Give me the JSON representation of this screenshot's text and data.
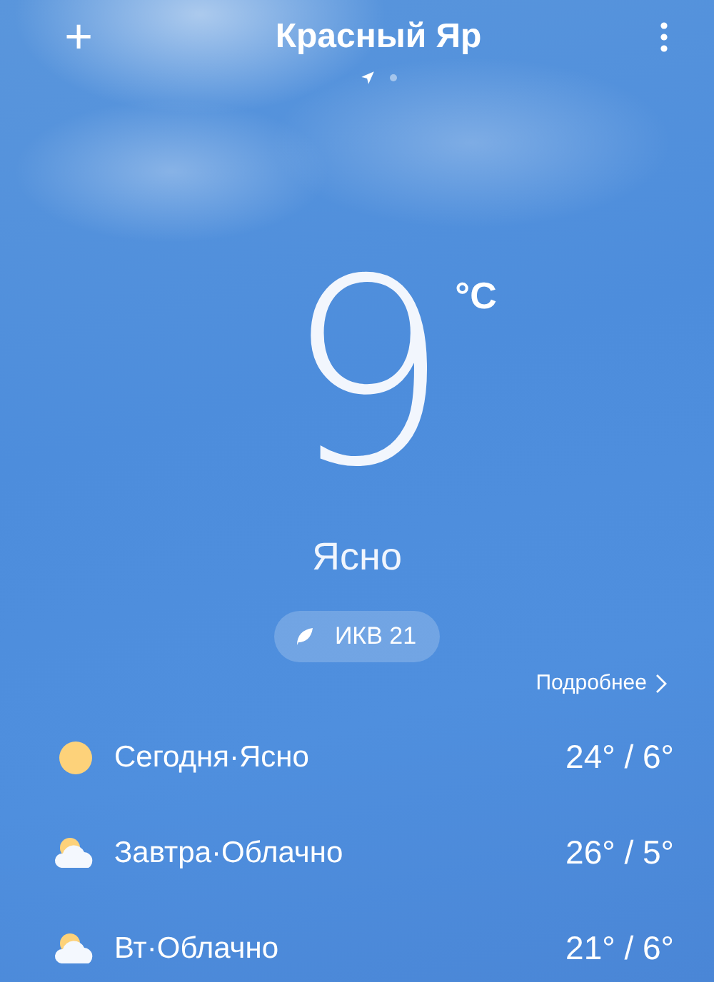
{
  "header": {
    "add_button": "+",
    "city": "Красный Яр",
    "pages": [
      {
        "kind": "location",
        "selected": true
      },
      {
        "kind": "dot",
        "selected": false
      }
    ]
  },
  "current": {
    "temperature": "9",
    "unit": "°C",
    "condition": "Ясно",
    "aqi": "ИКВ 21"
  },
  "more_link": "Подробнее",
  "forecast": [
    {
      "kind": "sunny",
      "label": "Сегодня·Ясно",
      "temps": "24° / 6°"
    },
    {
      "kind": "cloudy",
      "label": "Завтра·Облачно",
      "temps": "26° / 5°"
    },
    {
      "kind": "cloudy",
      "label": "Вт·Облачно",
      "temps": "21° / 6°"
    }
  ]
}
